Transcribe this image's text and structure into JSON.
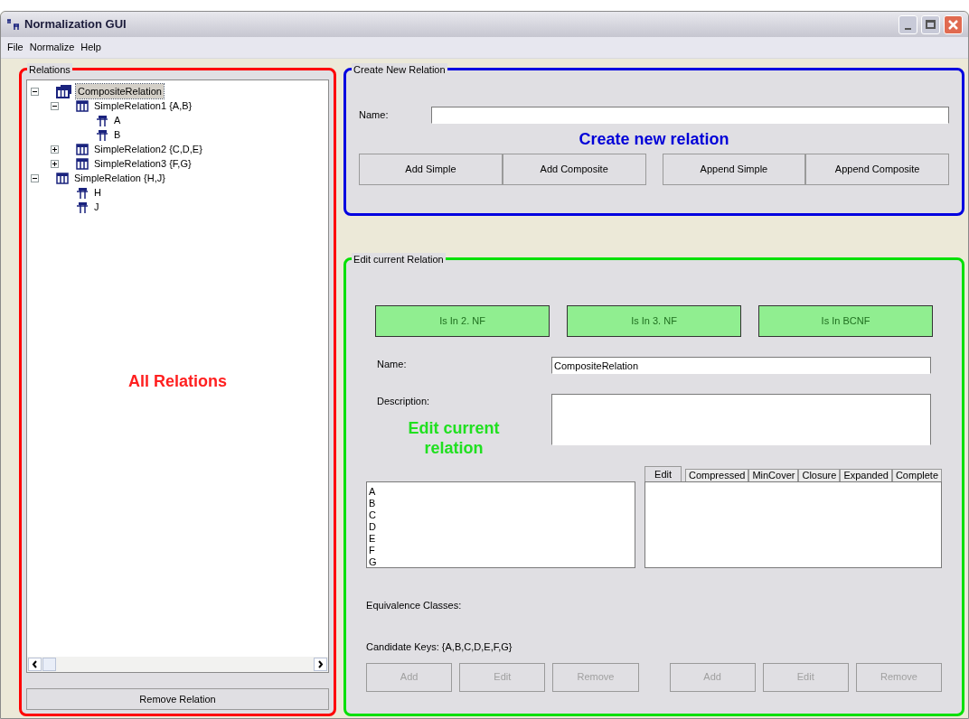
{
  "window": {
    "title": "Normalization GUI"
  },
  "menu": [
    "File",
    "Normalize",
    "Help"
  ],
  "relations_panel": {
    "title": "Relations",
    "tree": [
      {
        "kind": "composite",
        "label": "CompositeRelation",
        "selected": true,
        "expanded": true,
        "children": [
          {
            "kind": "simple",
            "label": "SimpleRelation1 {A,B}",
            "selected": false,
            "expanded": true,
            "children": [
              {
                "kind": "attribute",
                "label": "A",
                "selected": false
              },
              {
                "kind": "attribute",
                "label": "B",
                "selected": false
              }
            ]
          },
          {
            "kind": "simple",
            "label": "SimpleRelation2 {C,D,E}",
            "selected": false,
            "expanded": false
          },
          {
            "kind": "simple",
            "label": "SimpleRelation3 {F,G}",
            "selected": false,
            "expanded": false
          }
        ]
      },
      {
        "kind": "simple",
        "label": "SimpleRelation {H,J}",
        "selected": false,
        "expanded": true,
        "children": [
          {
            "kind": "attribute",
            "label": "H",
            "selected": false
          },
          {
            "kind": "attribute",
            "label": "J",
            "selected": false
          }
        ]
      }
    ],
    "annotation": "All Relations",
    "button": "Remove Relation"
  },
  "create_panel": {
    "title": "Create New Relation",
    "name_label": "Name:",
    "annotation": "Create new relation",
    "buttons": [
      "Add Simple",
      "Add Composite",
      "Append Simple",
      "Append Composite"
    ]
  },
  "edit_panel": {
    "title": "Edit current Relation",
    "checks": [
      {
        "label": "Is In 2. NF",
        "passed": true
      },
      {
        "label": "Is In 3. NF",
        "passed": true
      },
      {
        "label": "Is In BCNF",
        "passed": true
      }
    ],
    "name_label": "Name:",
    "name_value": "CompositeRelation",
    "description_label": "Description:",
    "annotation": "Edit current relation",
    "attributes": [
      "A",
      "B",
      "C",
      "D",
      "E",
      "F",
      "G"
    ],
    "tabs": [
      {
        "label": "Edit",
        "selected": true
      },
      {
        "label": "Compressed",
        "selected": false
      },
      {
        "label": "MinCover",
        "selected": false
      },
      {
        "label": "Closure",
        "selected": false
      },
      {
        "label": "Expanded",
        "selected": false
      },
      {
        "label": "Complete",
        "selected": false
      }
    ],
    "equivalence_label": "Equivalence Classes:",
    "candidate_keys": "Candidate Keys: {A,B,C,D,E,F,G}",
    "left_buttons": [
      {
        "label": "Add",
        "disabled": true
      },
      {
        "label": "Edit",
        "disabled": true
      },
      {
        "label": "Remove",
        "disabled": true
      }
    ],
    "right_buttons": [
      {
        "label": "Add",
        "disabled": true
      },
      {
        "label": "Edit",
        "disabled": true
      },
      {
        "label": "Remove",
        "disabled": true
      }
    ]
  }
}
